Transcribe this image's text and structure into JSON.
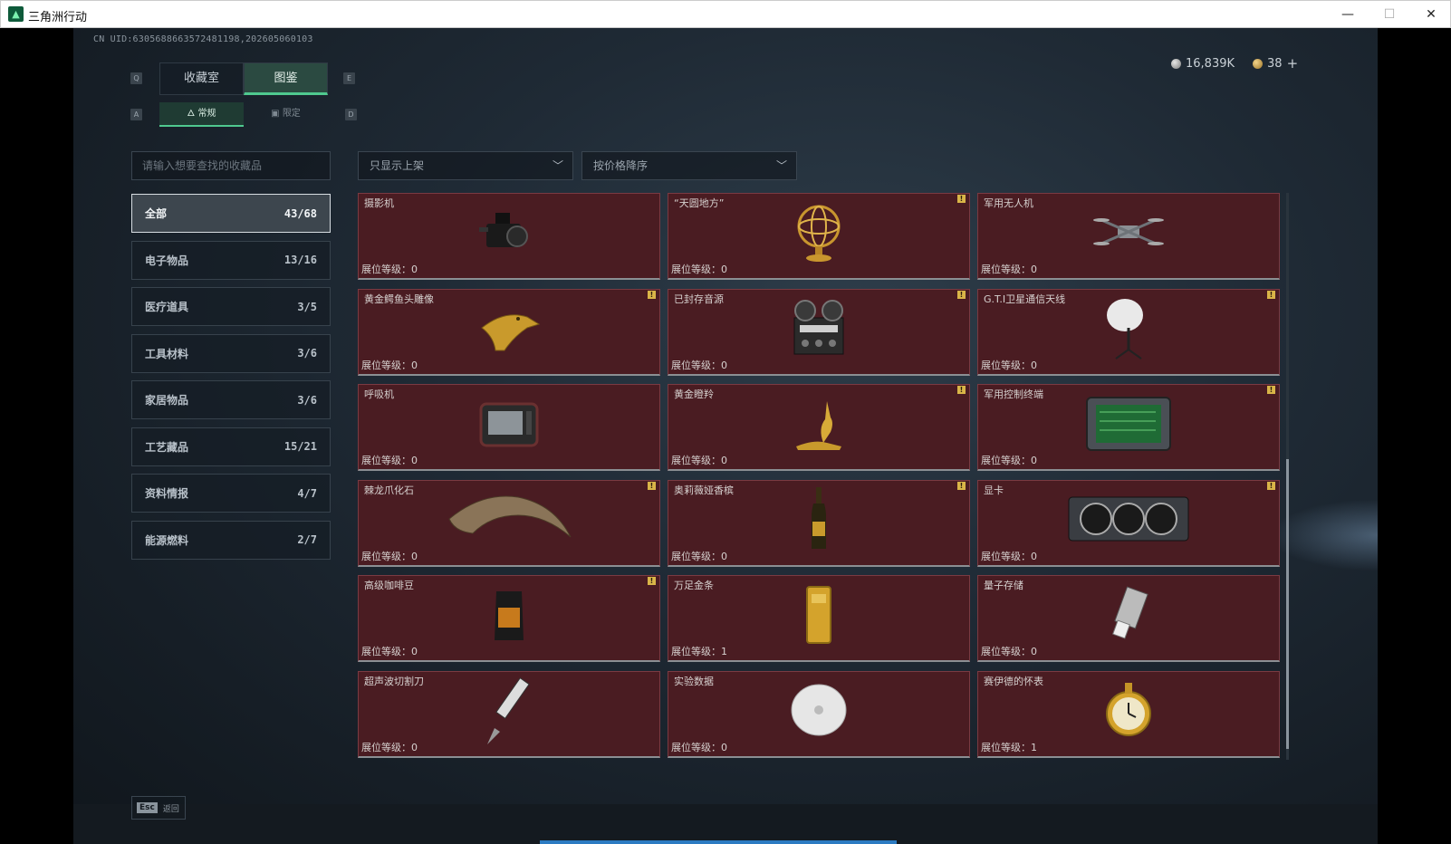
{
  "window": {
    "title": "三角洲行动",
    "minimize": "—",
    "maximize": "☐",
    "close": "✕"
  },
  "header": {
    "uid": "CN UID:6305688663572481198,202605060103",
    "currency_silver": "16,839K",
    "currency_gold": "38",
    "add_label": "+"
  },
  "keys": {
    "q": "Q",
    "e": "E",
    "a": "A",
    "d": "D"
  },
  "tabs": [
    {
      "label": "收藏室"
    },
    {
      "label": "图鉴"
    }
  ],
  "subtabs": [
    {
      "label": "常规"
    },
    {
      "label": "限定"
    }
  ],
  "search": {
    "placeholder": "请输入想要查找的收藏品"
  },
  "filters": {
    "availability": "只显示上架",
    "sort": "按价格降序"
  },
  "categories": [
    {
      "label": "全部",
      "count": "43/68"
    },
    {
      "label": "电子物品",
      "count": "13/16"
    },
    {
      "label": "医疗道具",
      "count": "3/5"
    },
    {
      "label": "工具材料",
      "count": "3/6"
    },
    {
      "label": "家居物品",
      "count": "3/6"
    },
    {
      "label": "工艺藏品",
      "count": "15/21"
    },
    {
      "label": "资料情报",
      "count": "4/7"
    },
    {
      "label": "能源燃料",
      "count": "2/7"
    }
  ],
  "level_prefix": "展位等级：",
  "items": [
    {
      "name": "摄影机",
      "level": "0",
      "icon": "camera-icon",
      "flag": false
    },
    {
      "name": "“天圆地方”",
      "level": "0",
      "icon": "armillary-sphere-icon",
      "flag": true
    },
    {
      "name": "军用无人机",
      "level": "0",
      "icon": "drone-icon",
      "flag": false
    },
    {
      "name": "黄金鳄鱼头雕像",
      "level": "0",
      "icon": "gold-crocodile-head-icon",
      "flag": true
    },
    {
      "name": "已封存音源",
      "level": "0",
      "icon": "tape-recorder-icon",
      "flag": true
    },
    {
      "name": "G.T.I卫星通信天线",
      "level": "0",
      "icon": "satellite-dish-icon",
      "flag": true
    },
    {
      "name": "呼吸机",
      "level": "0",
      "icon": "ventilator-icon",
      "flag": false
    },
    {
      "name": "黄金瞪羚",
      "level": "0",
      "icon": "gold-gazelle-icon",
      "flag": true
    },
    {
      "name": "军用控制终端",
      "level": "0",
      "icon": "control-terminal-icon",
      "flag": true
    },
    {
      "name": "棘龙爪化石",
      "level": "0",
      "icon": "claw-fossil-icon",
      "flag": true
    },
    {
      "name": "奥莉薇娅香槟",
      "level": "0",
      "icon": "champagne-icon",
      "flag": true
    },
    {
      "name": "显卡",
      "level": "0",
      "icon": "graphics-card-icon",
      "flag": true
    },
    {
      "name": "高级咖啡豆",
      "level": "0",
      "icon": "coffee-bag-icon",
      "flag": true
    },
    {
      "name": "万足金条",
      "level": "1",
      "icon": "gold-bar-icon",
      "flag": false
    },
    {
      "name": "量子存储",
      "level": "0",
      "icon": "quantum-storage-icon",
      "flag": false
    },
    {
      "name": "超声波切割刀",
      "level": "0",
      "icon": "ultrasonic-knife-icon",
      "flag": false
    },
    {
      "name": "实验数据",
      "level": "0",
      "icon": "data-disc-icon",
      "flag": false
    },
    {
      "name": "赛伊德的怀表",
      "level": "1",
      "icon": "pocket-watch-icon",
      "flag": false
    }
  ],
  "footer": {
    "esc_key": "Esc",
    "back_label": "返回"
  },
  "colors": {
    "accent": "#4fc98f",
    "card": "#4a1c22",
    "badge": "#d9b548"
  }
}
